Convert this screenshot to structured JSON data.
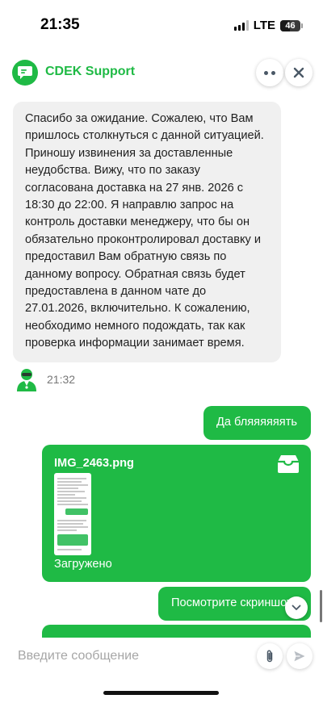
{
  "status_bar": {
    "time": "21:35",
    "network": "LTE",
    "battery": "46",
    "battery_level": 0.46
  },
  "header": {
    "title": "CDEK Support",
    "logo_icon": "chat-bubble-icon",
    "more_icon": "more-dots-icon",
    "close_icon": "close-icon",
    "accent_color": "#1fba45"
  },
  "messages": {
    "agent": {
      "text": "Спасибо за ожидание. Сожалею, что Вам пришлось столкнуться с данной ситуацией. Приношу извинения за доставленные неудобства. Вижу, что по заказу согласована доставка на 27 янв. 2026 с 18:30 до 22:00. Я направлю запрос на контроль доставки менеджеру, что бы он обязательно проконтролировал доставку и предоставил Вам обратную связь по данному вопросу. Обратная связь будет предоставлена в данном чате до 27.01.2026, включительно. К сожалению, необходимо немного подождать, так как проверка информации занимает время.",
      "time": "21:32",
      "avatar_icon": "support-agent-avatar-icon"
    },
    "user_1": {
      "text": "Да бляяяяяять"
    },
    "file": {
      "name": "IMG_2463.png",
      "status": "Загружено",
      "icon": "file-tray-icon"
    },
    "user_2": {
      "text": "Посмотрите скриншот"
    }
  },
  "composer": {
    "placeholder": "Введите сообщение",
    "attach_icon": "paperclip-icon",
    "send_icon": "send-icon",
    "scroll_icon": "chevron-down-icon"
  }
}
